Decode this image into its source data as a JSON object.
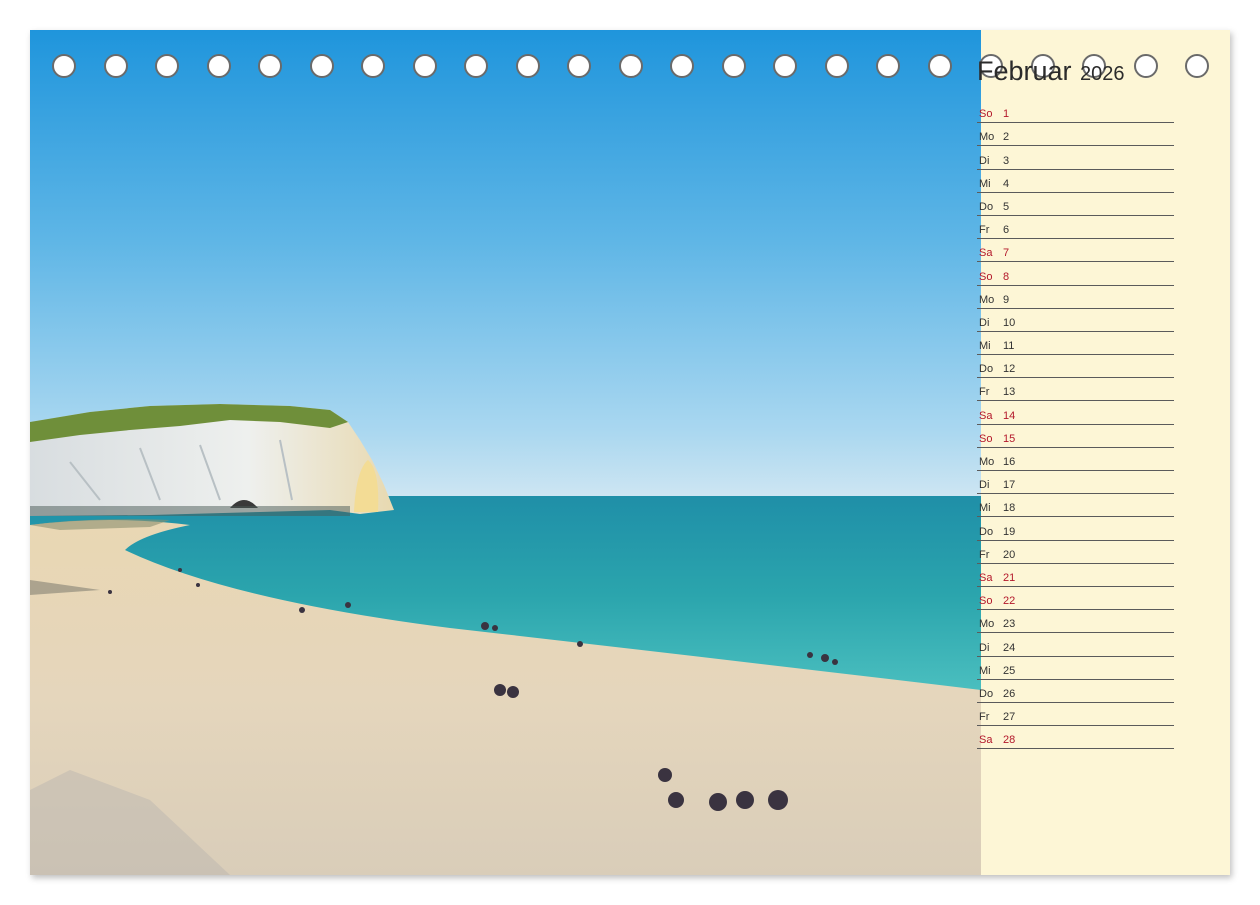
{
  "calendar": {
    "month": "Februar",
    "year": "2026",
    "days": [
      {
        "wd": "So",
        "num": "1",
        "weekend": true
      },
      {
        "wd": "Mo",
        "num": "2",
        "weekend": false
      },
      {
        "wd": "Di",
        "num": "3",
        "weekend": false
      },
      {
        "wd": "Mi",
        "num": "4",
        "weekend": false
      },
      {
        "wd": "Do",
        "num": "5",
        "weekend": false
      },
      {
        "wd": "Fr",
        "num": "6",
        "weekend": false
      },
      {
        "wd": "Sa",
        "num": "7",
        "weekend": true
      },
      {
        "wd": "So",
        "num": "8",
        "weekend": true
      },
      {
        "wd": "Mo",
        "num": "9",
        "weekend": false
      },
      {
        "wd": "Di",
        "num": "10",
        "weekend": false
      },
      {
        "wd": "Mi",
        "num": "11",
        "weekend": false
      },
      {
        "wd": "Do",
        "num": "12",
        "weekend": false
      },
      {
        "wd": "Fr",
        "num": "13",
        "weekend": false
      },
      {
        "wd": "Sa",
        "num": "14",
        "weekend": true
      },
      {
        "wd": "So",
        "num": "15",
        "weekend": true
      },
      {
        "wd": "Mo",
        "num": "16",
        "weekend": false
      },
      {
        "wd": "Di",
        "num": "17",
        "weekend": false
      },
      {
        "wd": "Mi",
        "num": "18",
        "weekend": false
      },
      {
        "wd": "Do",
        "num": "19",
        "weekend": false
      },
      {
        "wd": "Fr",
        "num": "20",
        "weekend": false
      },
      {
        "wd": "Sa",
        "num": "21",
        "weekend": true
      },
      {
        "wd": "So",
        "num": "22",
        "weekend": true
      },
      {
        "wd": "Mo",
        "num": "23",
        "weekend": false
      },
      {
        "wd": "Di",
        "num": "24",
        "weekend": false
      },
      {
        "wd": "Mi",
        "num": "25",
        "weekend": false
      },
      {
        "wd": "Do",
        "num": "26",
        "weekend": false
      },
      {
        "wd": "Fr",
        "num": "27",
        "weekend": false
      },
      {
        "wd": "Sa",
        "num": "28",
        "weekend": true
      }
    ]
  },
  "colors": {
    "weekend": "#b3182b",
    "panel": "#fdf6d6",
    "sky": "#2f9fde",
    "sea": "#2ea8ad",
    "sand": "#e6d6b8"
  }
}
